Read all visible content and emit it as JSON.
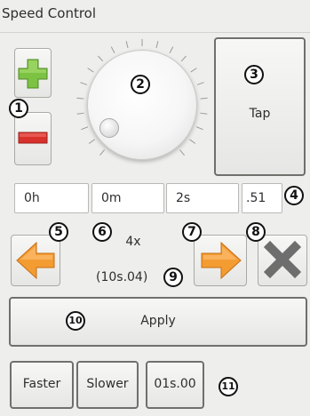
{
  "window": {
    "title": "Speed Control"
  },
  "controls": {
    "tap_label": "Tap",
    "hours": "0h",
    "minutes": "0m",
    "seconds": "2s",
    "fraction": ".51",
    "speed": "4x",
    "duration": "(10s.04)",
    "apply_label": "Apply"
  },
  "presets": [
    "Faster",
    "Slower",
    "01s.00"
  ],
  "markers": [
    "1",
    "2",
    "3",
    "4",
    "5",
    "6",
    "7",
    "8",
    "9",
    "10",
    "11"
  ],
  "icons": {
    "plus": "plus-icon",
    "minus": "minus-icon",
    "left": "arrow-left-icon",
    "right": "arrow-right-icon",
    "close": "close-icon"
  },
  "colors": {
    "plus_green": "#7cc243",
    "minus_red": "#d8312c",
    "arrow_orange": "#f39c32",
    "close_gray": "#6e6e6e"
  }
}
